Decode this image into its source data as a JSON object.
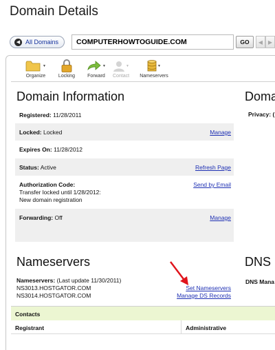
{
  "page_title": "Domain Details",
  "nav": {
    "all_domains_label": "All Domains",
    "domain_value": "COMPUTERHOWTOGUIDE.COM",
    "go_label": "GO"
  },
  "toolbar": {
    "items": [
      {
        "label": "Organize",
        "icon": "folder-icon"
      },
      {
        "label": "Locking",
        "icon": "lock-icon"
      },
      {
        "label": "Forward",
        "icon": "forward-arrow-icon"
      },
      {
        "label": "Contact",
        "icon": "contact-icon"
      },
      {
        "label": "Nameservers",
        "icon": "database-icon"
      }
    ]
  },
  "domain_info": {
    "title": "Domain Information",
    "registered_label": "Registered:",
    "registered_value": "11/28/2011",
    "locked_label": "Locked:",
    "locked_value": "Locked",
    "locked_link": "Manage",
    "expires_label": "Expires On:",
    "expires_value": "11/28/2012",
    "status_label": "Status:",
    "status_value": "Active",
    "status_link": "Refresh Page",
    "auth_label": "Authorization Code:",
    "auth_line1": "Transfer locked until 1/28/2012:",
    "auth_line2": "New domain registration",
    "auth_link": "Send by Email",
    "forwarding_label": "Forwarding:",
    "forwarding_value": "Off",
    "forwarding_link": "Manage"
  },
  "right_col": {
    "title_partial": "Doma",
    "privacy_partial": "Privacy: (",
    "dns_title": "DNS",
    "dns_sub": "DNS Mana"
  },
  "nameservers": {
    "title": "Nameservers",
    "label": "Nameservers:",
    "updated": "(Last update 11/30/2011)",
    "ns1": "NS3013.HOSTGATOR.COM",
    "ns2": "NS3014.HOSTGATOR.COM",
    "set_link": "Set Nameservers",
    "ds_link": "Manage DS Records"
  },
  "contacts": {
    "title": "Contacts",
    "col_registrant": "Registrant",
    "col_administrative": "Administrative"
  },
  "colors": {
    "link": "#1d2fb3",
    "contacts_bar": "#ecf6d2",
    "row_grey": "#efefef",
    "annotation_arrow": "#e0141c"
  }
}
